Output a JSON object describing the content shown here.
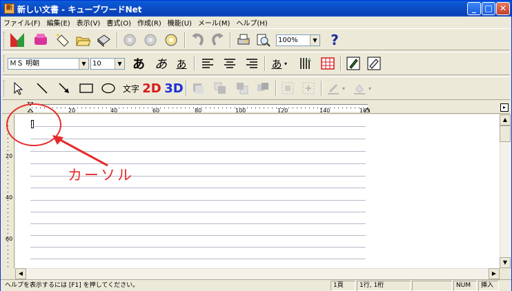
{
  "window": {
    "title": "新しい文書 - キューブワードNet",
    "app_icon_glyph": "新"
  },
  "window_controls": {
    "minimize": "_",
    "maximize": "□",
    "close": "✕"
  },
  "menu": [
    "ファイル(F)",
    "編集(E)",
    "表示(V)",
    "書式(O)",
    "作成(R)",
    "機能(U)",
    "メール(M)",
    "ヘルプ(H)"
  ],
  "toolbar1": {
    "zoom": "100%",
    "icons": [
      "new-doc-icon",
      "stamp-icon",
      "new-icon",
      "open-icon",
      "save-icon",
      "cut-icon",
      "copy-icon",
      "paste-icon",
      "undo-icon",
      "redo-icon",
      "print-icon",
      "preview-icon",
      "help-icon"
    ]
  },
  "toolbar2": {
    "font_name": "ＭＳ 明朝",
    "font_size": "10",
    "char_bold": "あ",
    "char_italic": "あ",
    "char_underline": "あ",
    "char_color": "あ"
  },
  "toolbar3": {
    "text_tool": "文字",
    "two_d": "2D",
    "three_d": "3D"
  },
  "ruler": {
    "ticks": [
      "20",
      "40",
      "60",
      "80",
      "100",
      "120",
      "140",
      "160"
    ]
  },
  "vruler": {
    "ticks": [
      "20",
      "40",
      "60"
    ]
  },
  "statusbar": {
    "help": "ヘルプを表示するには [F1] を押してください。",
    "page": "1頁",
    "position": "1行, 1桁",
    "num": "NUM",
    "insert": "挿入"
  },
  "annotation": {
    "label": "カーソル",
    "color": "#e52a2a"
  }
}
